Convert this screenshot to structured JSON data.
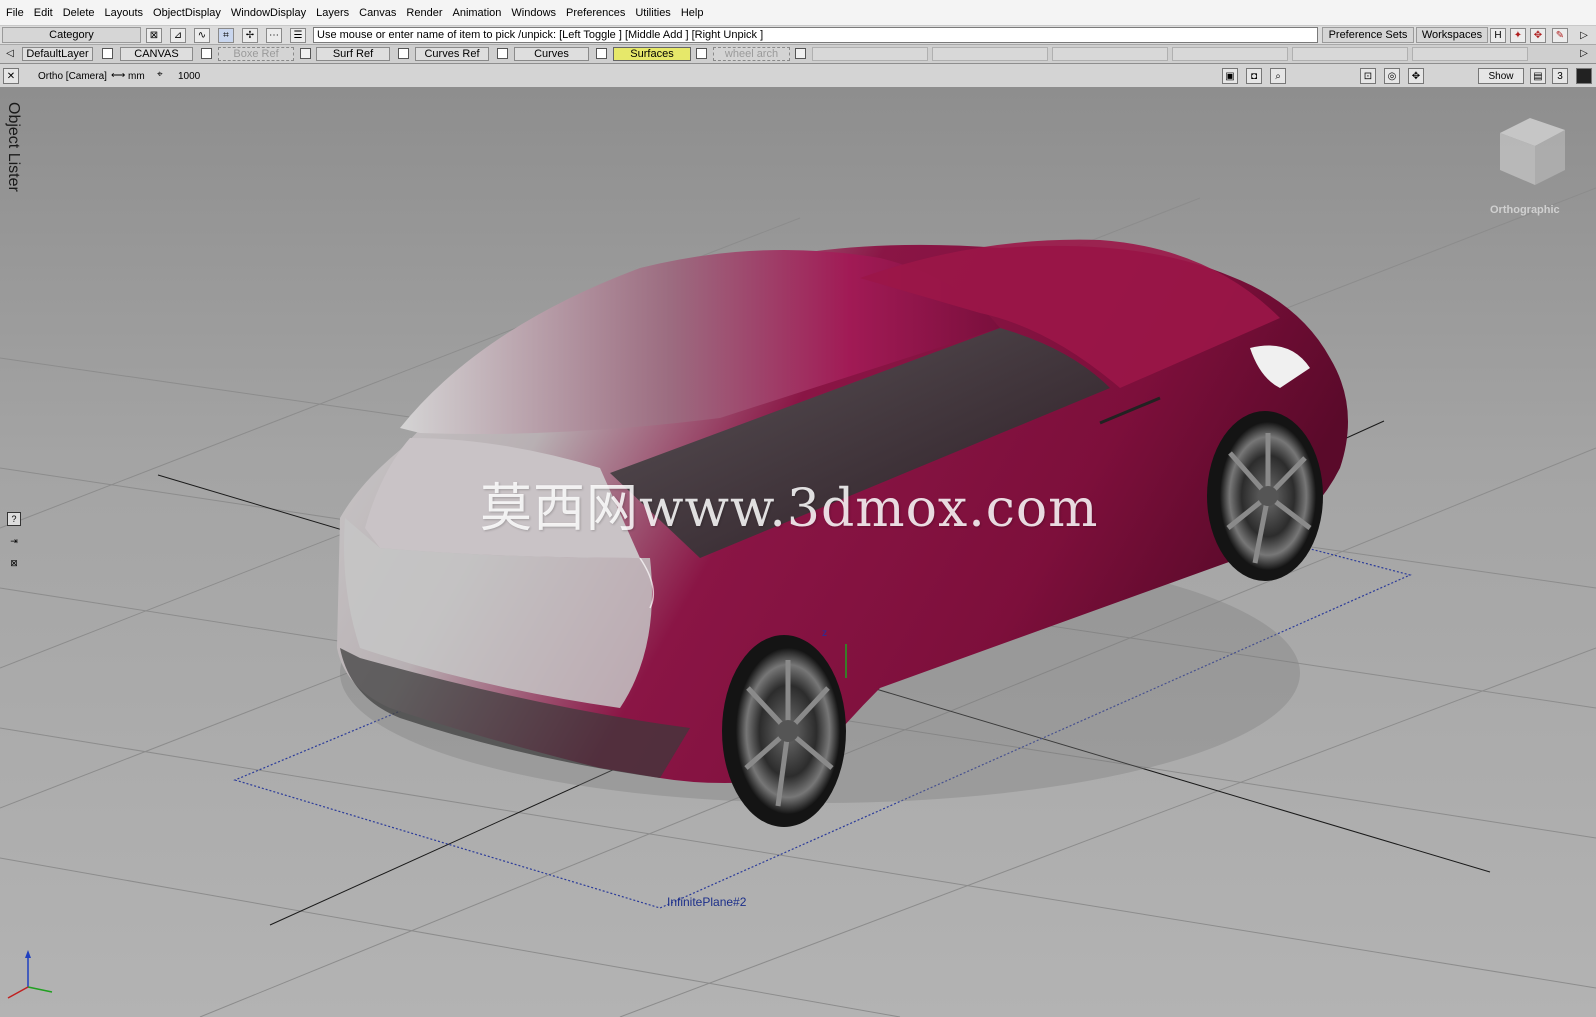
{
  "menubar": {
    "items": [
      "File",
      "Edit",
      "Delete",
      "Layouts",
      "ObjectDisplay",
      "WindowDisplay",
      "Layers",
      "Canvas",
      "Render",
      "Animation",
      "Windows",
      "Preferences",
      "Utilities",
      "Help"
    ]
  },
  "toolbar": {
    "category_label": "Category",
    "prompt_text": "Use mouse or enter name of item to pick /unpick: [Left Toggle ] [Middle Add ] [Right Unpick ]",
    "preference_sets_label": "Preference Sets",
    "workspaces_label": "Workspaces"
  },
  "layers": {
    "items": [
      {
        "label": "DefaultLayer",
        "state": "normal"
      },
      {
        "label": "CANVAS",
        "state": "normal"
      },
      {
        "label": "Boxe Ref",
        "state": "dim"
      },
      {
        "label": "Surf Ref",
        "state": "normal"
      },
      {
        "label": "Curves Ref",
        "state": "normal"
      },
      {
        "label": "Curves",
        "state": "normal"
      },
      {
        "label": "Surfaces",
        "state": "active"
      },
      {
        "label": "wheel arch",
        "state": "dim"
      }
    ],
    "active_color": "#e6e86a"
  },
  "viewbar": {
    "camera_label": "Ortho [Camera]",
    "units_label": "mm",
    "grid_value": "1000",
    "show_label": "Show",
    "layout_number": "3"
  },
  "viewport": {
    "side_panel_label": "Object Lister",
    "viewcube_label": "Orthographic",
    "plane_label": "InfinitePlane#2",
    "watermark": "莫西网www.3dmox.com",
    "car_color": "#8a1040"
  }
}
